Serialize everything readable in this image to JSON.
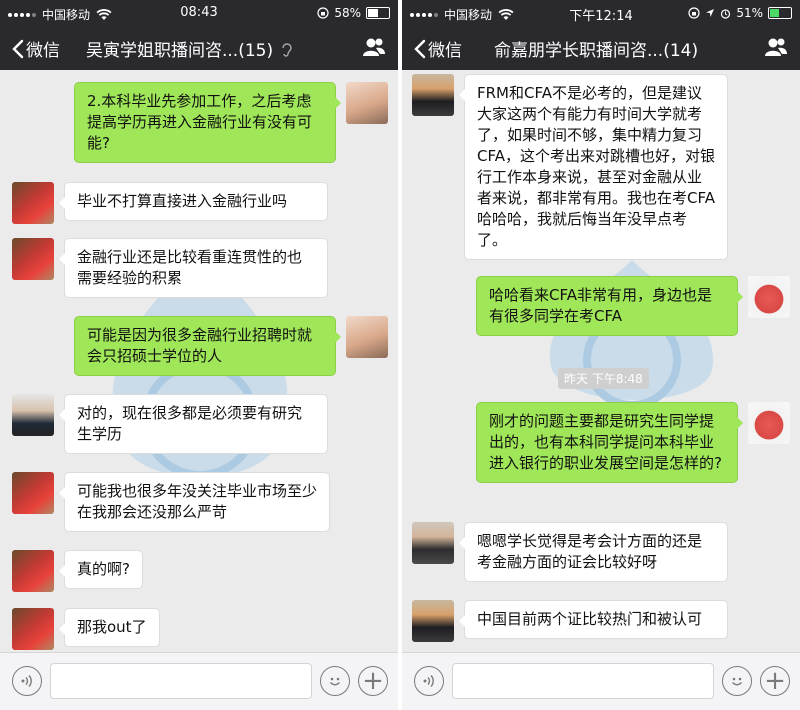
{
  "left": {
    "status": {
      "carrier": "中国移动",
      "time": "08:43",
      "battery": "58%",
      "battery_level": 0.58
    },
    "nav": {
      "back_label": "微信",
      "title": "吴寅学姐职播间咨...(15)"
    },
    "messages": [
      {
        "side": "right",
        "text": "2.本科毕业先参加工作，之后考虑提高学历再进入金融行业有没有可能?"
      },
      {
        "side": "left",
        "text": "毕业不打算直接进入金融行业吗"
      },
      {
        "side": "left",
        "text": "金融行业还是比较看重连贯性的也需要经验的积累"
      },
      {
        "side": "right",
        "text": "可能是因为很多金融行业招聘时就会只招硕士学位的人"
      },
      {
        "side": "left",
        "text": "对的，现在很多都是必须要有研究生学历"
      },
      {
        "side": "left",
        "text": "可能我也很多年没关注毕业市场至少在我那会还没那么严苛"
      },
      {
        "side": "left",
        "text": "真的啊?"
      },
      {
        "side": "left",
        "text": "那我out了"
      }
    ]
  },
  "right": {
    "status": {
      "carrier": "中国移动",
      "time": "下午12:14",
      "battery": "51%",
      "battery_level": 0.51
    },
    "nav": {
      "back_label": "微信",
      "title": "俞嘉朋学长职播间咨...(14)"
    },
    "timestamp": "昨天 下午8:48",
    "messages": [
      {
        "side": "left",
        "text": "FRM和CFA不是必考的，但是建议大家这两个有能力有时间大学就考了，如果时间不够，集中精力复习CFA，这个考出来对跳槽也好，对银行工作本身来说，甚至对金融从业者来说，都非常有用。我也在考CFA哈哈哈，我就后悔当年没早点考了。"
      },
      {
        "side": "right",
        "text": "哈哈看来CFA非常有用，身边也是有很多同学在考CFA"
      },
      {
        "side": "right",
        "text": "刚才的问题主要都是研究生同学提出的，也有本科同学提问本科毕业进入银行的职业发展空间是怎样的?"
      },
      {
        "side": "left",
        "text": "嗯嗯学长觉得是考会计方面的还是考金融方面的证会比较好呀"
      },
      {
        "side": "left",
        "text": "中国目前两个证比较热门和被认可"
      }
    ]
  },
  "colors": {
    "nav_bg": "#2a2a2e",
    "chat_bg": "#ebebeb",
    "green_bubble": "#9fe658",
    "white_bubble": "#ffffff"
  },
  "icons": [
    "back-chevron-icon",
    "ear-icon",
    "contacts-icon",
    "voice-icon",
    "emoji-icon",
    "plus-icon",
    "wifi-icon",
    "lock-rotation-icon",
    "location-icon",
    "alarm-icon"
  ]
}
